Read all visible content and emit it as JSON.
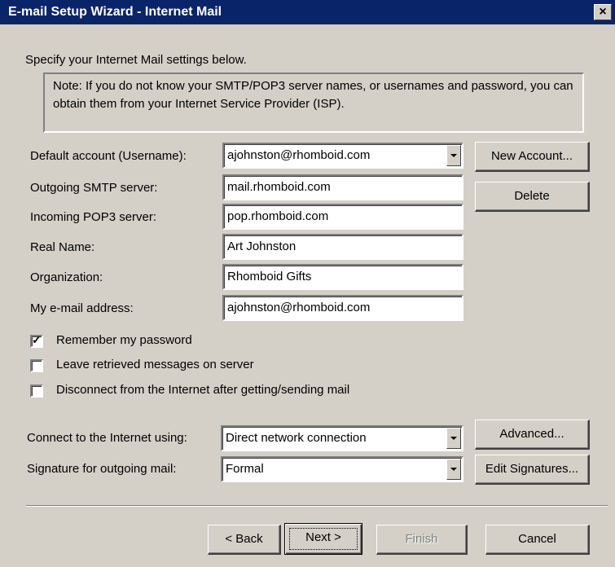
{
  "window": {
    "title": "E-mail Setup Wizard - Internet Mail",
    "close_glyph": "×"
  },
  "instructions": "Specify your Internet Mail settings below.",
  "note": "Note: If you do not know your SMTP/POP3 server names, or usernames and password, you can obtain them from your Internet Service Provider (ISP).",
  "fields": {
    "default_account": {
      "label": "Default account (Username):",
      "value": "ajohnston@rhomboid.com"
    },
    "smtp": {
      "label": "Outgoing SMTP server:",
      "value": "mail.rhomboid.com"
    },
    "pop3": {
      "label": "Incoming POP3 server:",
      "value": "pop.rhomboid.com"
    },
    "real_name": {
      "label": "Real Name:",
      "value": "Art Johnston"
    },
    "organization": {
      "label": "Organization:",
      "value": "Rhomboid Gifts"
    },
    "email": {
      "label": "My e-mail address:",
      "value": "ajohnston@rhomboid.com"
    }
  },
  "checkboxes": {
    "remember_password": {
      "label": "Remember my password",
      "checked": true
    },
    "leave_messages": {
      "label": "Leave retrieved messages on server",
      "checked": false
    },
    "disconnect": {
      "label": "Disconnect from the Internet after getting/sending mail",
      "checked": false
    }
  },
  "connection": {
    "label": "Connect to the Internet using:",
    "value": "Direct network connection"
  },
  "signature": {
    "label": "Signature for outgoing mail:",
    "value": "Formal"
  },
  "buttons": {
    "new_account": "New Account...",
    "delete": "Delete",
    "advanced": "Advanced...",
    "edit_signatures": "Edit Signatures...",
    "back": "< Back",
    "next": "Next >",
    "finish": "Finish",
    "cancel": "Cancel"
  },
  "colors": {
    "dialog_bg": "#d4d0c8",
    "titlebar_bg": "#0a246a",
    "titlebar_text": "#ffffff",
    "disabled_text": "#808080"
  },
  "checkmark_glyph": "✓"
}
